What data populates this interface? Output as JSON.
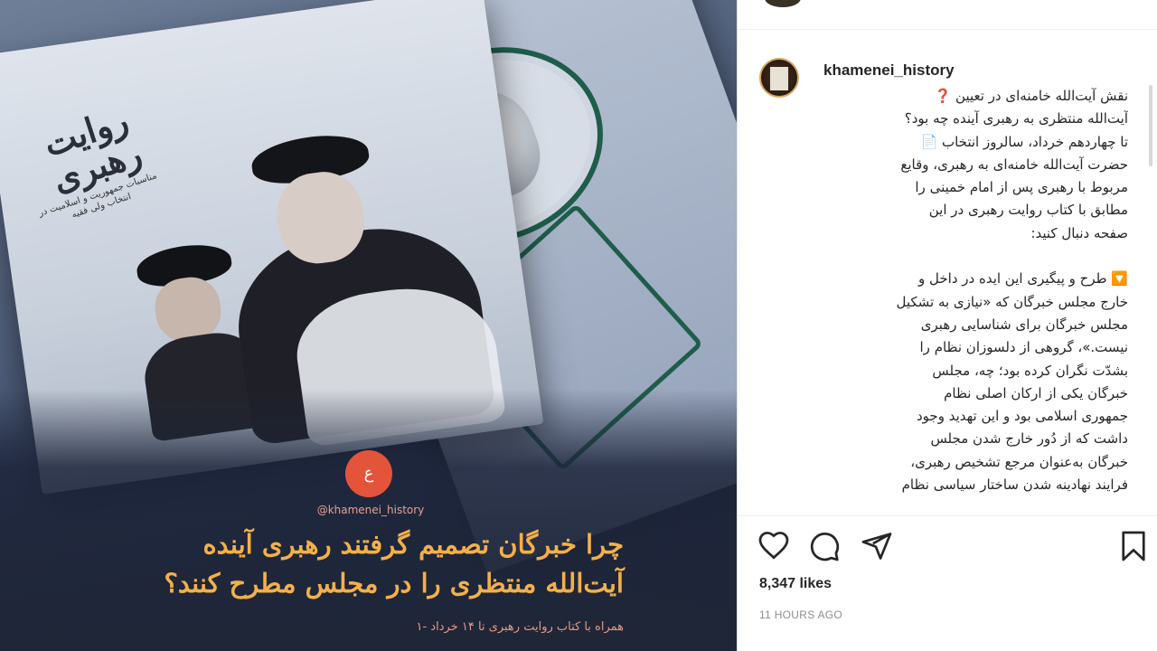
{
  "post_image": {
    "book_title": "روایت رهبری",
    "book_subtitle": "مناسبات جمهوریت و اسلامیت در انتخاب ولی فقیه",
    "logo_text": "ع",
    "handle": "@khamenei_history",
    "headline_line1": "چرا خبرگان تصمیم گرفتند رهبری آینده",
    "headline_line2": "آیت‌الله منتظری را در مجلس مطرح کنند؟",
    "caption_line": "همراه با کتاب روایت رهبری تا ۱۴ خرداد -۱"
  },
  "post": {
    "username": "khamenei_history",
    "caption": "نقش آیت‌الله خامنه‌ای در تعیین ❓\nآیت‌الله منتظری به رهبری آینده چه بود؟\nتا چهاردهم خرداد، سالروز انتخاب 📄\nحضرت آیت‌الله خامنه‌ای به رهبری، وقایع\nمربوط با رهبری پس از امام خمینی را\nمطابق با کتاب روایت رهبری در این\nصفحه دنبال کنید:\n\n🔽 طرح و پیگیری این ایده در داخل و\nخارج مجلس خبرگان که «نیازی به تشکیل\nمجلس خبرگان برای شناسایی رهبری\nنیست.»، گروهی از دلسوزان نظام را\nبشدّت نگران کرده بود؛ چه، مجلس\nخبرگان یکی از ارکان اصلی نظام\nجمهوری اسلامی بود و این تهدید وجود\nداشت که از دُور خارج شدن مجلس\nخبرگان به‌عنوان مرجع تشخیص رهبری،\nفرایند نهادینه شدن ساختار سیاسی نظام",
    "likes": "8,347 likes",
    "time_ago": "11 HOURS AGO"
  }
}
